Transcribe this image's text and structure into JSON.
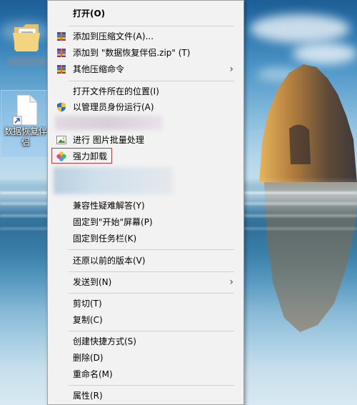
{
  "desktop": {
    "icons": [
      {
        "name": "",
        "type": "folder"
      },
      {
        "name": "数据恢复伴侣",
        "type": "shortcut"
      }
    ]
  },
  "context_menu": {
    "items": [
      {
        "label": "打开(O)",
        "bold": true
      },
      {
        "label": "添加到压缩文件(A)...",
        "icon": "winrar-archive-icon"
      },
      {
        "label": "添加到 \"数据恢复伴侣.zip\" (T)",
        "icon": "winrar-archive-icon"
      },
      {
        "label": "其他压缩命令",
        "icon": "winrar-archive-icon",
        "submenu": true
      },
      {
        "label": "打开文件所在的位置(I)"
      },
      {
        "label": "以管理员身份运行(A)",
        "icon": "uac-shield-icon"
      },
      {
        "label": "进行 图片批量处理",
        "icon": "image-batch-icon"
      },
      {
        "label": "强力卸载",
        "icon": "uninstall-flower-icon",
        "highlighted": true
      },
      {
        "label": "兼容性疑难解答(Y)"
      },
      {
        "label": "固定到\"开始\"屏幕(P)"
      },
      {
        "label": "固定到任务栏(K)"
      },
      {
        "label": "还原以前的版本(V)"
      },
      {
        "label": "发送到(N)",
        "submenu": true
      },
      {
        "label": "剪切(T)"
      },
      {
        "label": "复制(C)"
      },
      {
        "label": "创建快捷方式(S)"
      },
      {
        "label": "删除(D)"
      },
      {
        "label": "重命名(M)"
      },
      {
        "label": "属性(R)"
      }
    ],
    "submenu_glyph": "›"
  }
}
